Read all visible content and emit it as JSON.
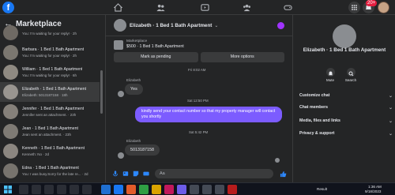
{
  "sidebar": {
    "title": "Marketplace",
    "items": [
      {
        "title": "",
        "sub": "You: I'm waiting for your reply! · 2h"
      },
      {
        "title": "Barbara · 1 Bed 1 Bath Apartment",
        "sub": "You: I'm waiting for your reply! · 2h"
      },
      {
        "title": "William · 1 Bed 1 Bath Apartment",
        "sub": "You: I'm waiting for your reply! · 6h"
      },
      {
        "title": "Elizabeth · 1 Bed 1 Bath Apartment",
        "sub": "Elizabeth: 5013187158 · 18h"
      },
      {
        "title": "Jennifer · 1 Bed 1 Bath Apartment",
        "sub": "Jennifer sent an attachment. · 23h"
      },
      {
        "title": "Jean · 1 Bed 1 Bath Apartment",
        "sub": "Jean sent an attachment. · 23h"
      },
      {
        "title": "Kenneth · 1 Bed 1 Bath Apartment",
        "sub": "Kenneth: No · 2d"
      },
      {
        "title": "Edna · 1 Bed 1 Bath Apartment",
        "sub": "You: I was busy.Sorry for the late re... · 2d"
      }
    ]
  },
  "chat": {
    "name": "Elizabeth · 1 Bed 1 Bath Apartment",
    "listing_label": "Marketplace",
    "listing_detail": "$500 · 1 Bed 1 Bath Apartment",
    "pending_label": "Mark as pending",
    "more_label": "More options",
    "time1": "Fri 8:02 AM",
    "sender1": "Elizabeth",
    "msg1": "Yes",
    "time2": "Sat 12:50 PM",
    "msg_out": "kindly send your contact number so that my property manager will contact you shortly",
    "time3": "Sat 5:42 PM",
    "sender2": "Elizabeth",
    "msg2": "5013187158",
    "composer_placeholder": "Aa"
  },
  "right": {
    "name": "Elizabeth · 1 Bed 1 Bath Apartment",
    "mute": "Mute",
    "search": "Search",
    "sections": [
      "Customize chat",
      "Chat members",
      "Media, files and links",
      "Privacy & support"
    ]
  },
  "top": {
    "badge": "20+"
  },
  "taskbar": {
    "result": "Result",
    "time": "1:36 AM",
    "date": "9/18/2023"
  }
}
